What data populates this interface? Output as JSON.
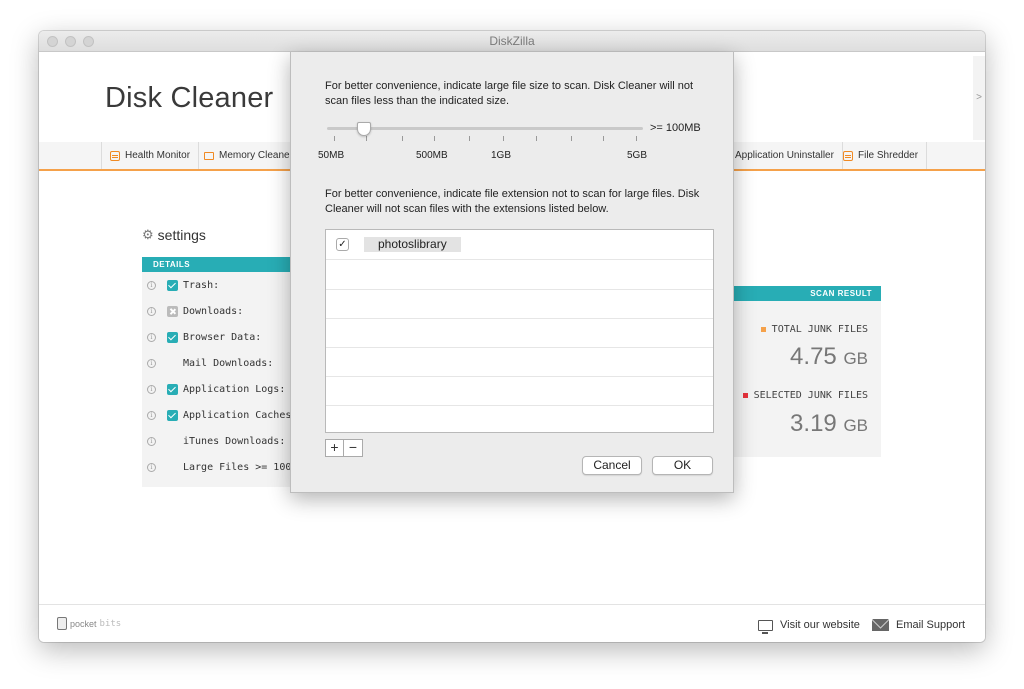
{
  "window": {
    "title": "DiskZilla"
  },
  "header": {
    "app_title": "Disk Cleaner",
    "right_arrow": ">"
  },
  "tabs": [
    {
      "label": "Health Monitor"
    },
    {
      "label": "Memory Cleaner"
    },
    {
      "label": "Application Uninstaller"
    },
    {
      "label": "File Shredder"
    }
  ],
  "settings": {
    "heading": "settings",
    "details_header": "DETAILS",
    "items": [
      {
        "label": "Trash:",
        "state": "checked"
      },
      {
        "label": "Downloads:",
        "state": "excluded"
      },
      {
        "label": "Browser Data:",
        "state": "checked"
      },
      {
        "label": "Mail Downloads:",
        "state": "none"
      },
      {
        "label": "Application Logs:",
        "state": "checked"
      },
      {
        "label": "Application Caches:",
        "state": "checked"
      },
      {
        "label": "iTunes Downloads:",
        "state": "none"
      },
      {
        "label": "Large Files >= 100MB:",
        "state": "none"
      }
    ]
  },
  "scan_result": {
    "header": "SCAN RESULT",
    "total_label": "TOTAL JUNK FILES",
    "total_value": "4.75",
    "total_unit": "GB",
    "selected_label": "SELECTED JUNK FILES",
    "selected_value": "3.19",
    "selected_unit": "GB",
    "colors": {
      "total": "#f5a14a",
      "selected": "#e8323c"
    }
  },
  "dialog": {
    "size_text": "For better convenience, indicate large file size to scan. Disk Cleaner will not scan files less than the indicated size.",
    "slider_readout": ">= 100MB",
    "slider_value_mb": 100,
    "tick_labels": [
      "50MB",
      "500MB",
      "1GB",
      "5GB"
    ],
    "ext_text": "For better convenience, indicate file extension not to scan for large files. Disk Cleaner will not scan files with the extensions listed below.",
    "extensions": [
      {
        "checked": true,
        "check_glyph": "✓",
        "name": "photoslibrary"
      }
    ],
    "add_label": "+",
    "remove_label": "−",
    "cancel_label": "Cancel",
    "ok_label": "OK"
  },
  "footer": {
    "brand_prefix": "pocket",
    "brand_suffix": "bits",
    "website_label": "Visit our website",
    "email_label": "Email Support"
  },
  "colors": {
    "accent": "#28adb5",
    "tab_underline": "#f5a14a",
    "icon_orange": "#f08a24"
  }
}
